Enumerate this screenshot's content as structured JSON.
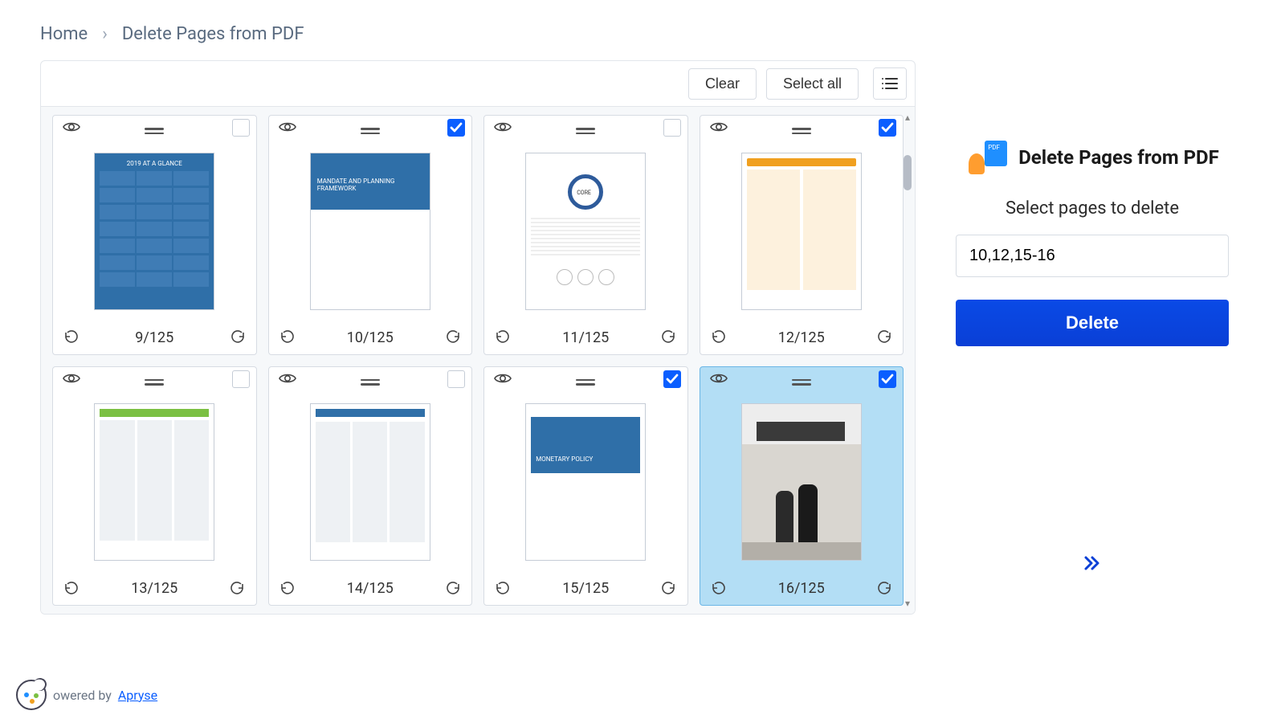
{
  "breadcrumb": {
    "home": "Home",
    "current": "Delete Pages from PDF"
  },
  "toolbar": {
    "clear": "Clear",
    "select_all": "Select all"
  },
  "total_pages": 125,
  "pages": [
    {
      "num": 9,
      "label": "9/125",
      "checked": false,
      "mock": "stats",
      "title": "2019 AT A GLANCE"
    },
    {
      "num": 10,
      "label": "10/125",
      "checked": true,
      "mock": "mandate",
      "title": "MANDATE AND PLANNING FRAMEWORK"
    },
    {
      "num": 11,
      "label": "11/125",
      "checked": false,
      "mock": "core",
      "title": ""
    },
    {
      "num": 12,
      "label": "12/125",
      "checked": true,
      "mock": "orange",
      "title": ""
    },
    {
      "num": 13,
      "label": "13/125",
      "checked": false,
      "mock": "green",
      "title": ""
    },
    {
      "num": 14,
      "label": "14/125",
      "checked": false,
      "mock": "blue2",
      "title": ""
    },
    {
      "num": 15,
      "label": "15/125",
      "checked": true,
      "mock": "monetary",
      "title": "MONETARY POLICY"
    },
    {
      "num": 16,
      "label": "16/125",
      "checked": true,
      "mock": "photo",
      "title": "",
      "highlighted": true
    }
  ],
  "sidepanel": {
    "title": "Delete Pages from PDF",
    "subtitle": "Select pages to delete",
    "input_value": "10,12,15-16",
    "delete_label": "Delete"
  },
  "footer": {
    "powered_by": "owered by",
    "brand": "Apryse"
  },
  "icons": {
    "eye": "eye-icon",
    "drag": "drag-handle-icon",
    "rotate_ccw": "rotate-ccw-icon",
    "rotate_cw": "rotate-cw-icon",
    "list": "list-view-icon",
    "chevron": "chevron-right-double-icon"
  }
}
